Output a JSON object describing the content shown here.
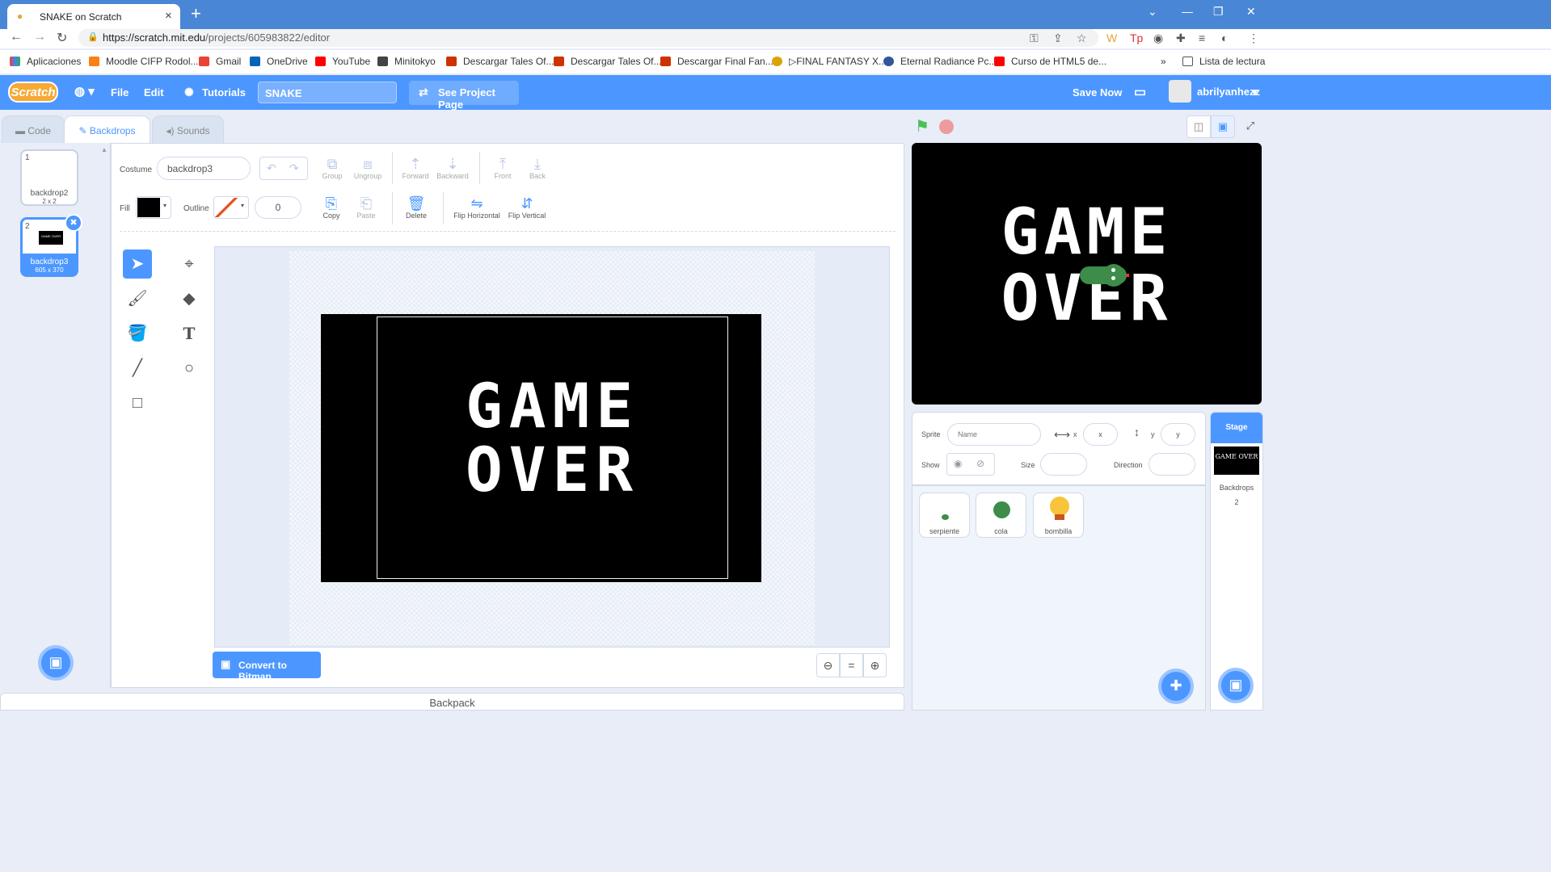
{
  "browser": {
    "tab_title": "SNAKE on Scratch",
    "url_host": "https://scratch.mit.edu",
    "url_path": "/projects/605983822/editor",
    "bookmarks": [
      {
        "label": "Aplicaciones",
        "color": "#4285f4"
      },
      {
        "label": "Moodle CIFP Rodol...",
        "color": "#f98012"
      },
      {
        "label": "Gmail",
        "color": "#ea4335"
      },
      {
        "label": "OneDrive",
        "color": "#0364b8"
      },
      {
        "label": "YouTube",
        "color": "#ff0000"
      },
      {
        "label": "Minitokyo",
        "color": "#444444"
      },
      {
        "label": "Descargar Tales Of...",
        "color": "#cc3300"
      },
      {
        "label": "Descargar Tales Of...",
        "color": "#cc3300"
      },
      {
        "label": "Descargar Final Fan...",
        "color": "#cc3300"
      },
      {
        "label": "▷FINAL FANTASY X...",
        "color": "#d9a400"
      },
      {
        "label": "Eternal Radiance Pc...",
        "color": "#335599"
      },
      {
        "label": "Curso de HTML5 de...",
        "color": "#ff0000"
      }
    ],
    "reading_list": "Lista de lectura",
    "more": "»"
  },
  "menubar": {
    "logo": "Scratch",
    "file": "File",
    "edit": "Edit",
    "tutorials": "Tutorials",
    "project_title": "SNAKE",
    "see_project": "See Project Page",
    "save_now": "Save Now",
    "username": "abrilyanhezz"
  },
  "tabs": {
    "code": "Code",
    "backdrops": "Backdrops",
    "sounds": "Sounds"
  },
  "costumes": [
    {
      "index": "1",
      "name": "backdrop2",
      "size": "2 x 2"
    },
    {
      "index": "2",
      "name": "backdrop3",
      "size": "605 x 370",
      "thumb_text": "GAME OVER"
    }
  ],
  "paint": {
    "costume_label": "Costume",
    "costume_name": "backdrop3",
    "fill_label": "Fill",
    "outline_label": "Outline",
    "outline_width": "0",
    "fill_color": "#000000",
    "buttons": {
      "group": "Group",
      "ungroup": "Ungroup",
      "forward": "Forward",
      "backward": "Backward",
      "front": "Front",
      "back": "Back",
      "copy": "Copy",
      "paste": "Paste",
      "delete": "Delete",
      "flip_h": "Flip Horizontal",
      "flip_v": "Flip Vertical"
    },
    "canvas_line1": "GAME",
    "canvas_line2": "OVER",
    "convert_bitmap": "Convert to Bitmap"
  },
  "backpack": "Backpack",
  "stage": {
    "line1": "GAME",
    "line2": "OVER"
  },
  "sprite_info": {
    "sprite_label": "Sprite",
    "name_placeholder": "Name",
    "x_label": "x",
    "x_placeholder": "x",
    "y_label": "y",
    "y_placeholder": "y",
    "show_label": "Show",
    "size_label": "Size",
    "direction_label": "Direction"
  },
  "sprites": [
    {
      "name": "serpiente"
    },
    {
      "name": "cola"
    },
    {
      "name": "bombilla"
    }
  ],
  "stage_panel": {
    "title": "Stage",
    "thumb_text": "GAME OVER",
    "backdrops_label": "Backdrops",
    "backdrops_count": "2"
  },
  "colors": {
    "scratch_blue": "#4c97ff",
    "chrome_blue": "#4a86d6"
  }
}
